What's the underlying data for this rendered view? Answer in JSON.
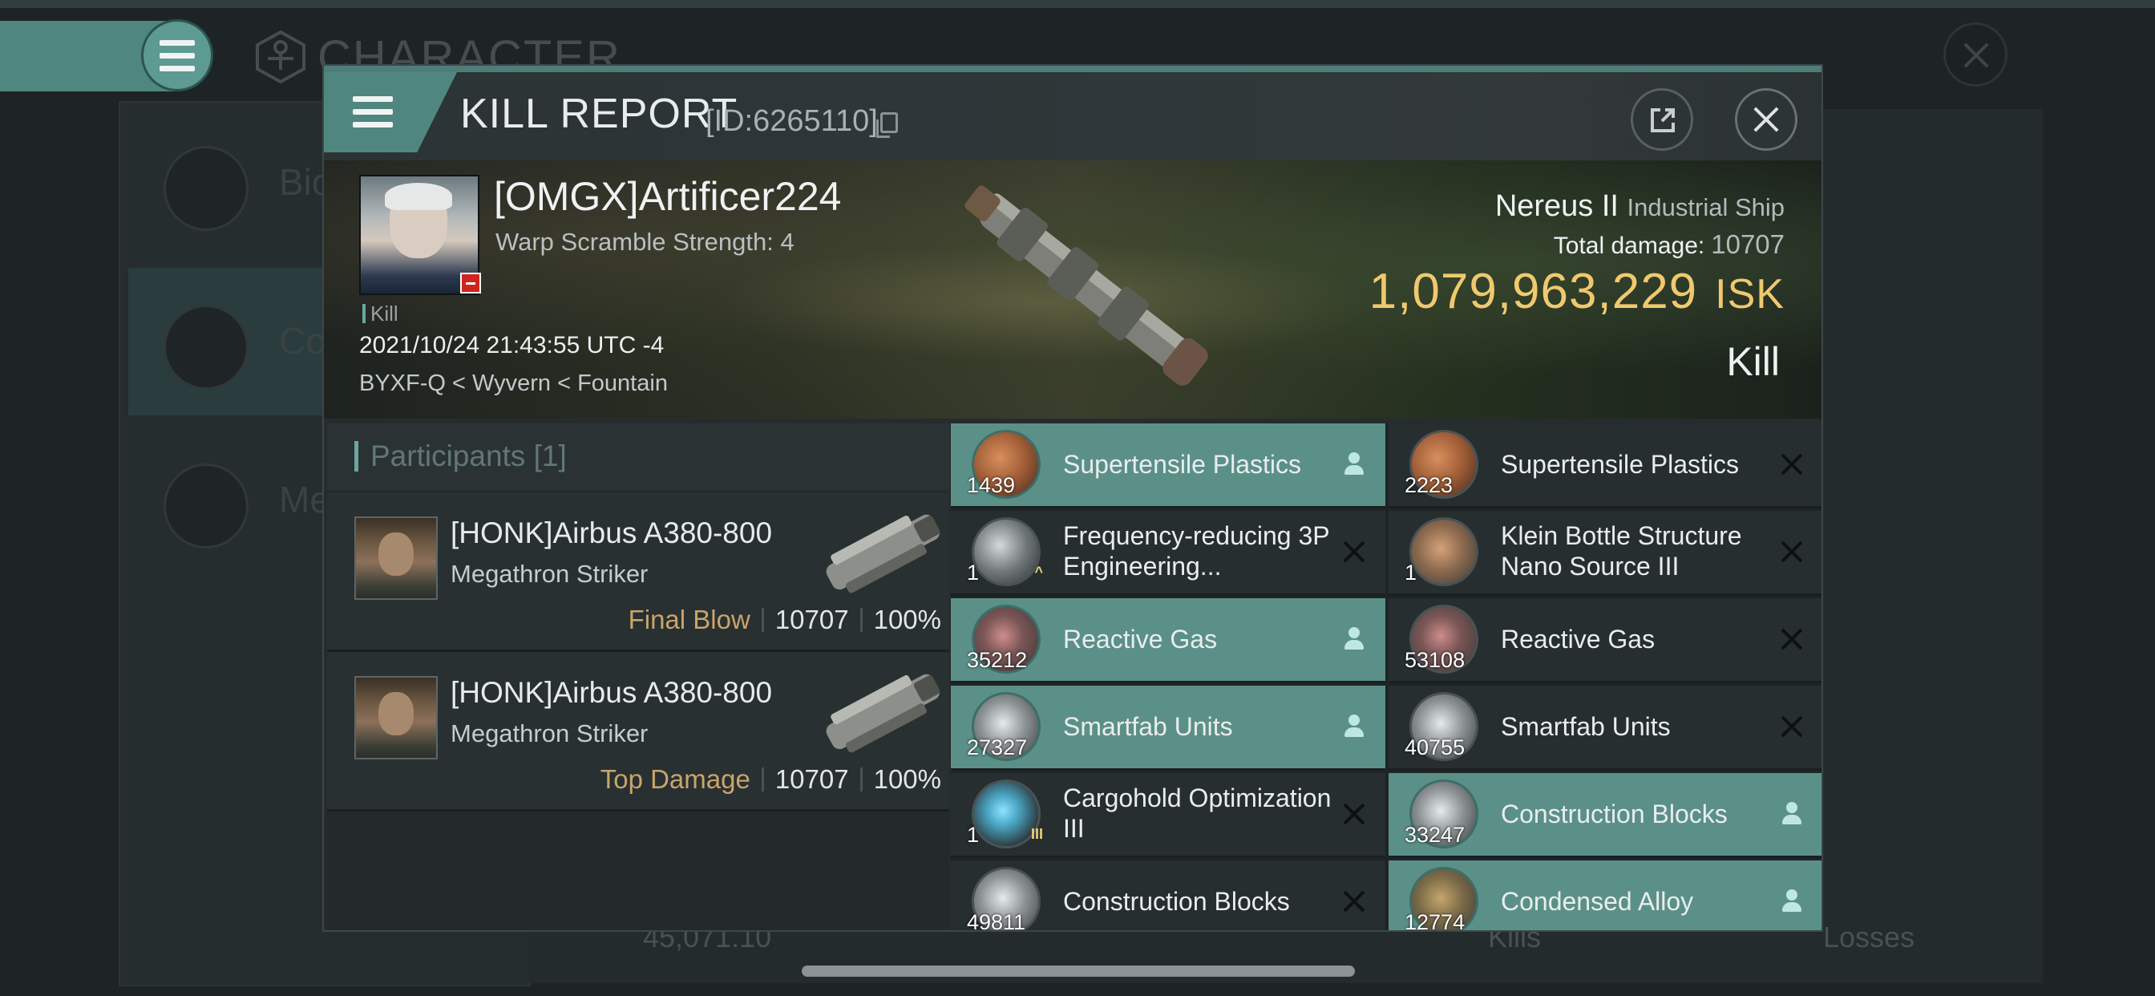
{
  "background": {
    "title": "CHARACTER",
    "side_items": [
      "Bio",
      "Co",
      "Me"
    ],
    "wallet_value": "45,071.10",
    "kills_label": "Kills",
    "losses_label": "Losses"
  },
  "dialog": {
    "title": "KILL REPORT",
    "report_id": "[ID:6265110]"
  },
  "victim": {
    "name": "[OMGX]Artificer224",
    "warp_scramble": "Warp Scramble Strength: 4",
    "event_tag": "Kill",
    "datetime": "2021/10/24 21:43:55 UTC -4",
    "location": "BYXF-Q < Wyvern < Fountain",
    "ship_name": "Nereus II",
    "ship_class": "Industrial Ship",
    "total_damage_label": "Total damage:",
    "total_damage": "10707",
    "isk_value": "1,079,963,229",
    "isk_unit": "ISK",
    "result": "Kill"
  },
  "participants": {
    "header": "Participants [1]",
    "rows": [
      {
        "name": "[HONK]Airbus A380-800",
        "ship": "Megathron Striker",
        "role": "Final Blow",
        "damage": "10707",
        "percent": "100%"
      },
      {
        "name": "[HONK]Airbus A380-800",
        "ship": "Megathron Striker",
        "role": "Top Damage",
        "damage": "10707",
        "percent": "100%"
      }
    ]
  },
  "items": [
    {
      "qty": "1439",
      "name": "Supertensile Plastics",
      "icon": "plastic-icon",
      "status": "dropped"
    },
    {
      "qty": "2223",
      "name": "Supertensile Plastics",
      "icon": "plastic-icon",
      "status": "destroyed"
    },
    {
      "qty": "1",
      "name": "Frequency-reducing 3P Engineering...",
      "icon": "chip-icon",
      "status": "destroyed"
    },
    {
      "qty": "1",
      "name": "Klein Bottle Structure Nano Source III",
      "icon": "klein-icon",
      "status": "destroyed"
    },
    {
      "qty": "35212",
      "name": "Reactive Gas",
      "icon": "gas-icon",
      "status": "dropped"
    },
    {
      "qty": "53108",
      "name": "Reactive Gas",
      "icon": "gas-icon",
      "status": "destroyed"
    },
    {
      "qty": "27327",
      "name": "Smartfab Units",
      "icon": "cube-icon",
      "status": "dropped"
    },
    {
      "qty": "40755",
      "name": "Smartfab Units",
      "icon": "cube-icon",
      "status": "destroyed"
    },
    {
      "qty": "1",
      "name": "Cargohold Optimization III",
      "icon": "cargo-icon",
      "status": "destroyed"
    },
    {
      "qty": "33247",
      "name": "Construction Blocks",
      "icon": "cube-icon",
      "status": "dropped"
    },
    {
      "qty": "49811",
      "name": "Construction Blocks",
      "icon": "cube-icon",
      "status": "destroyed"
    },
    {
      "qty": "12774",
      "name": "Condensed Alloy",
      "icon": "alloy-icon",
      "status": "dropped"
    }
  ],
  "colors": {
    "accent": "#5b9088",
    "isk": "#f0c96e",
    "final_blow": "#c9a46a"
  }
}
